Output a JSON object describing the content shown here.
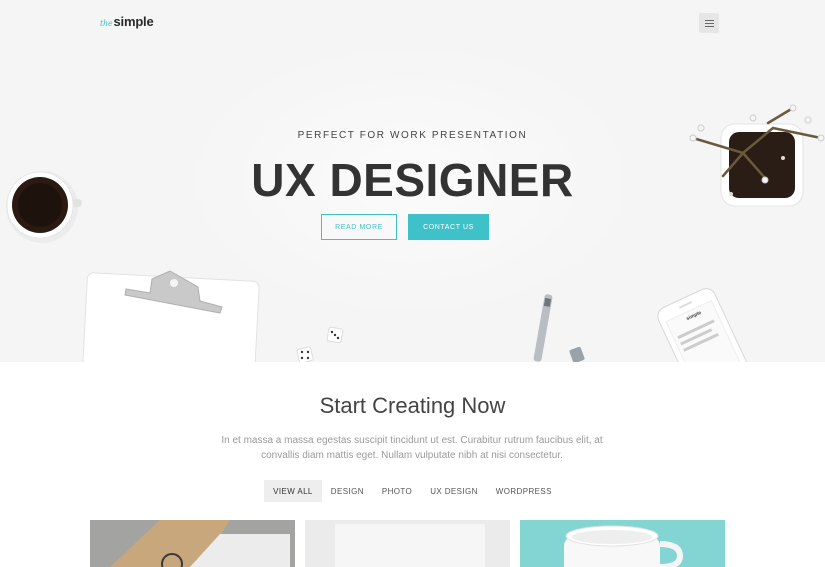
{
  "header": {
    "logo_prefix": "the",
    "logo_name": "simple",
    "menu_icon": "hamburger-menu-icon"
  },
  "hero": {
    "kicker": "PERFECT FOR WORK PRESENTATION",
    "title": "UX DESIGNER",
    "read_more_label": "READ MORE",
    "contact_label": "CONTACT US",
    "accent_color": "#3fc1c9",
    "phone_screen_logo": "simple"
  },
  "section": {
    "title": "Start Creating Now",
    "description": "In et massa a massa egestas suscipit tincidunt ut est. Curabitur rutrum faucibus elit, at convallis diam mattis eget. Nullam vulputate nibh at nisi consectetur.",
    "filters": [
      {
        "label": "VIEW ALL",
        "active": true
      },
      {
        "label": "DESIGN",
        "active": false
      },
      {
        "label": "PHOTO",
        "active": false
      },
      {
        "label": "UX DESIGN",
        "active": false
      },
      {
        "label": "WORDPRESS",
        "active": false
      }
    ]
  },
  "portfolio": {
    "items": [
      {
        "name": "branding-card-photo"
      },
      {
        "name": "blank-paper-photo"
      },
      {
        "name": "white-mug-photo"
      }
    ]
  }
}
